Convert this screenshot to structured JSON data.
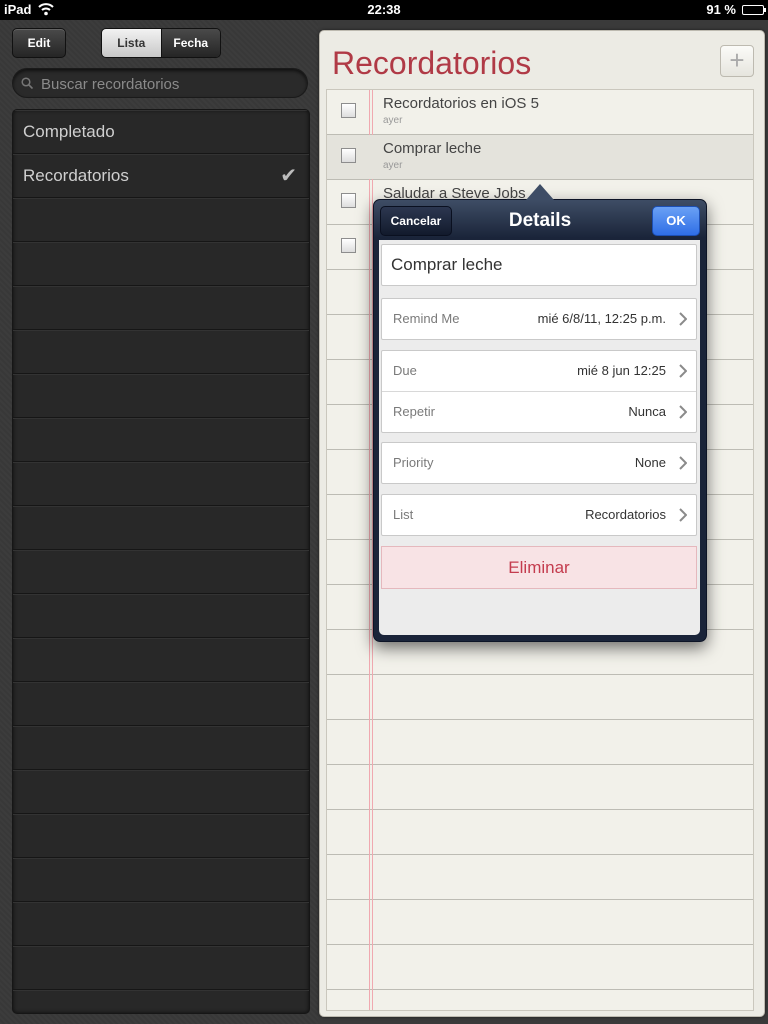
{
  "status": {
    "device": "iPad",
    "time": "22:38",
    "battery": "91 %"
  },
  "sidebar": {
    "edit_label": "Edit",
    "segments": [
      {
        "label": "Lista",
        "selected": true
      },
      {
        "label": "Fecha",
        "selected": false
      }
    ],
    "search_placeholder": "Buscar recordatorios",
    "lists": [
      {
        "label": "Completado",
        "checked": false
      },
      {
        "label": "Recordatorios",
        "checked": true
      }
    ],
    "check_glyph": "✔"
  },
  "main": {
    "title": "Recordatorios",
    "add_label": "+",
    "tasks": [
      {
        "title": "Recordatorios en iOS 5",
        "date": "ayer"
      },
      {
        "title": "Comprar leche",
        "date": "ayer"
      },
      {
        "title": "Saludar a Steve Jobs",
        "date": ""
      },
      {
        "title": "",
        "date": ""
      }
    ]
  },
  "popover": {
    "title": "Details",
    "cancel_label": "Cancelar",
    "ok_label": "OK",
    "name_value": "Comprar leche",
    "remind_me": {
      "label": "Remind Me",
      "value": "mié 6/8/11, 12:25 p.m."
    },
    "due": {
      "label": "Due",
      "value": "mié 8 jun  12:25"
    },
    "repeat": {
      "label": "Repetir",
      "value": "Nunca"
    },
    "priority": {
      "label": "Priority",
      "value": "None"
    },
    "list": {
      "label": "List",
      "value": "Recordatorios"
    },
    "delete_label": "Eliminar"
  },
  "colors": {
    "title": "#b03a46",
    "ok": "#2f6ee6",
    "delete": "#c43c4e"
  }
}
